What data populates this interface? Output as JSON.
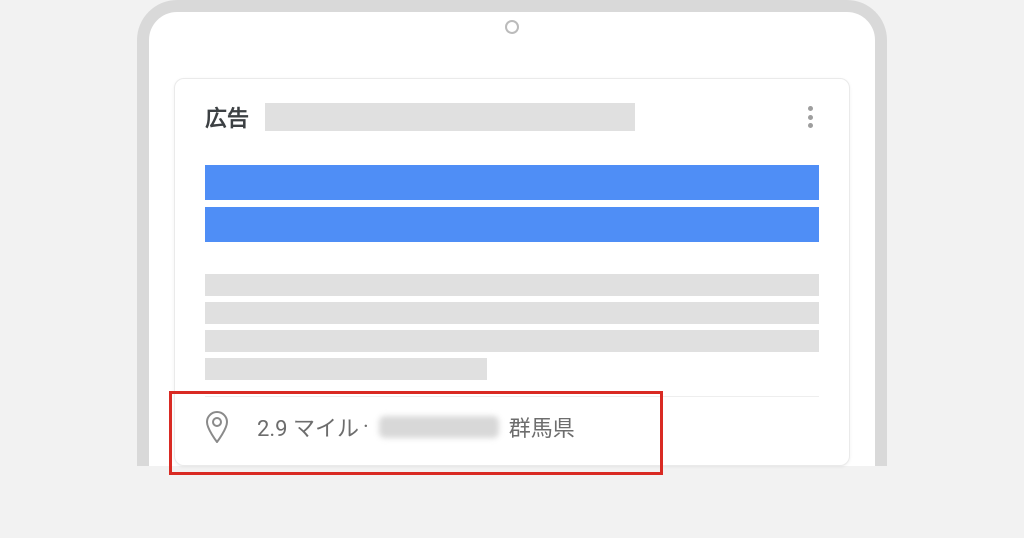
{
  "ad": {
    "label": "広告",
    "location": {
      "distance": "2.9 マイル",
      "region": "群馬県"
    }
  }
}
